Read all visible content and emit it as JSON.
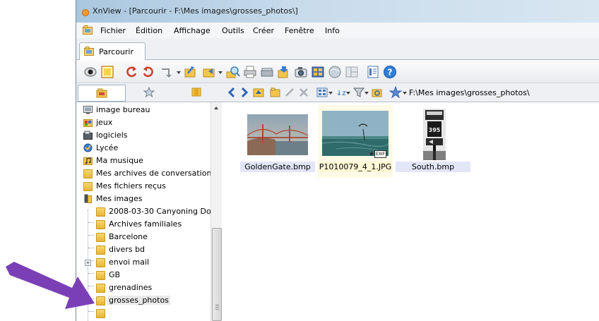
{
  "window": {
    "title": "XnView - [Parcourir - F:\\Mes images\\grosses_photos\\]"
  },
  "menu": [
    "Fichier",
    "Édition",
    "Affichage",
    "Outils",
    "Créer",
    "Fenêtre",
    "Info"
  ],
  "tab": {
    "label": "Parcourir"
  },
  "address": {
    "path": "F:\\Mes images\\grosses_photos\\"
  },
  "tree": {
    "items": [
      {
        "label": "image bureau",
        "icon": "desktop-image-icon"
      },
      {
        "label": "jeux",
        "icon": "games-icon"
      },
      {
        "label": "logiciels",
        "icon": "software-icon"
      },
      {
        "label": "Lycée",
        "icon": "school-icon"
      },
      {
        "label": "Ma musique",
        "icon": "music-folder-icon"
      },
      {
        "label": "Mes archives de conversation",
        "icon": "folder-icon"
      },
      {
        "label": "Mes fichiers reçus",
        "icon": "folder-icon"
      },
      {
        "label": "Mes images",
        "icon": "pictures-folder-icon"
      },
      {
        "label": "2008-03-30 Canyoning Do",
        "icon": "folder-icon"
      },
      {
        "label": "Archives familiales",
        "icon": "folder-icon"
      },
      {
        "label": "Barcelone",
        "icon": "folder-icon"
      },
      {
        "label": "divers bd",
        "icon": "folder-icon"
      },
      {
        "label": "envoi mail",
        "icon": "folder-icon"
      },
      {
        "label": "GB",
        "icon": "folder-icon"
      },
      {
        "label": "grenadines",
        "icon": "folder-icon"
      },
      {
        "label": "grosses_photos",
        "icon": "folder-icon"
      }
    ]
  },
  "files": [
    {
      "name": "GoldenGate.bmp"
    },
    {
      "name": "P1010079_4_1.JPG",
      "badge": "EXIF"
    },
    {
      "name": "South.bmp",
      "sign": "395"
    }
  ],
  "colors": {
    "arrow": "#7b3fb5",
    "selection_caption": "#fff8d6",
    "caption": "#e3e6f7"
  }
}
